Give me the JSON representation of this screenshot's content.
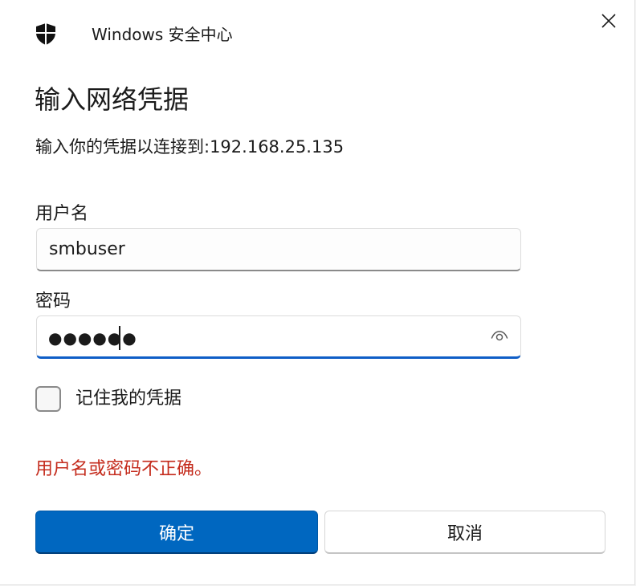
{
  "window": {
    "app_title": "Windows 安全中心",
    "app_icon": "shield-icon",
    "close_icon": "close-icon"
  },
  "dialog": {
    "heading": "输入网络凭据",
    "subtitle": "输入你的凭据以连接到:192.168.25.135"
  },
  "username": {
    "label": "用户名",
    "value": "smbuser"
  },
  "password": {
    "label": "密码",
    "masked_value": "●●●●●●",
    "reveal_icon": "eye-icon"
  },
  "remember": {
    "label": "记住我的凭据",
    "checked": false
  },
  "error_message": "用户名或密码不正确。",
  "buttons": {
    "ok_label": "确定",
    "cancel_label": "取消"
  },
  "colors": {
    "accent": "#0067c0",
    "focus_underline": "#0f5ec7",
    "error": "#c42b1c"
  }
}
